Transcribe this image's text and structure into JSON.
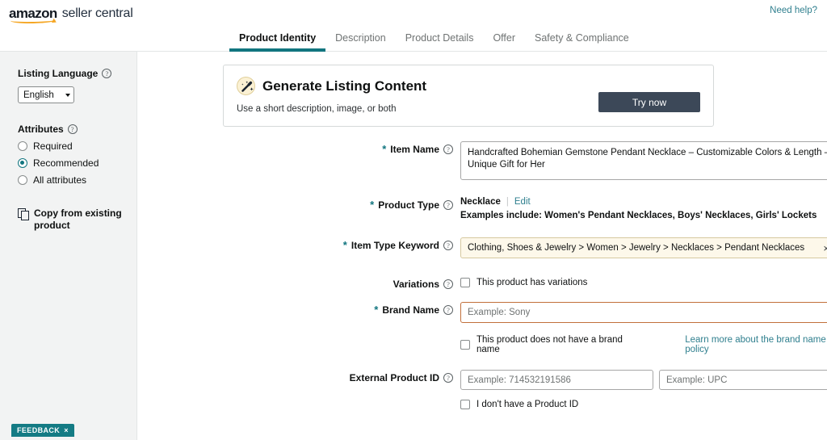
{
  "header": {
    "logo_amazon": "amazon",
    "logo_seller": "seller central",
    "need_help": "Need help?"
  },
  "tabs": [
    {
      "label": "Product Identity",
      "active": true
    },
    {
      "label": "Description",
      "active": false
    },
    {
      "label": "Product Details",
      "active": false
    },
    {
      "label": "Offer",
      "active": false
    },
    {
      "label": "Safety & Compliance",
      "active": false
    }
  ],
  "sidebar": {
    "listing_language_label": "Listing Language",
    "language_value": "English",
    "attributes_label": "Attributes",
    "attribute_options": [
      {
        "label": "Required",
        "selected": false
      },
      {
        "label": "Recommended",
        "selected": true
      },
      {
        "label": "All attributes",
        "selected": false
      }
    ],
    "copy_from_existing": "Copy from existing product",
    "feedback_label": "FEEDBACK",
    "feedback_close": "×"
  },
  "generate_card": {
    "title": "Generate Listing Content",
    "subtitle": "Use a short description, image, or both",
    "button_label": "Try now"
  },
  "form": {
    "item_name": {
      "label": "Item Name",
      "required": true,
      "value": "Handcrafted Bohemian Gemstone Pendant Necklace – Customizable Colors & Length – Unique Gift for Her"
    },
    "product_type": {
      "label": "Product Type",
      "required": true,
      "value": "Necklace",
      "separator": "|",
      "edit_label": "Edit",
      "examples": "Examples include: Women's Pendant Necklaces, Boys' Necklaces, Girls' Lockets"
    },
    "item_type_keyword": {
      "label": "Item Type Keyword",
      "required": true,
      "value": "Clothing, Shoes & Jewelry > Women > Jewelry > Necklaces > Pendant Necklaces",
      "clear_glyph": "×",
      "caret_glyph": "⌵"
    },
    "variations": {
      "label": "Variations",
      "checkbox_label": "This product has variations",
      "checked": false
    },
    "brand_name": {
      "label": "Brand Name",
      "required": true,
      "value": "",
      "placeholder": "Example: Sony",
      "no_brand_checkbox_label": "This product does not have a brand name",
      "no_brand_checked": false,
      "policy_link": "Learn more about the brand name policy"
    },
    "external_product_id": {
      "label": "External Product ID",
      "required": false,
      "value": "",
      "placeholder": "Example: 714532191586",
      "type_value": "Example: UPC",
      "no_id_checkbox_label": "I don't have a Product ID",
      "no_id_checked": false
    }
  },
  "colors": {
    "accent_teal": "#11757f",
    "link_teal": "#2f7f8e",
    "button_dark": "#3c4858",
    "brand_border_orange": "#c2703b",
    "keyword_bg": "#fdf8ea",
    "sidebar_bg": "#f2f3f3",
    "amazon_orange": "#f5a623"
  }
}
